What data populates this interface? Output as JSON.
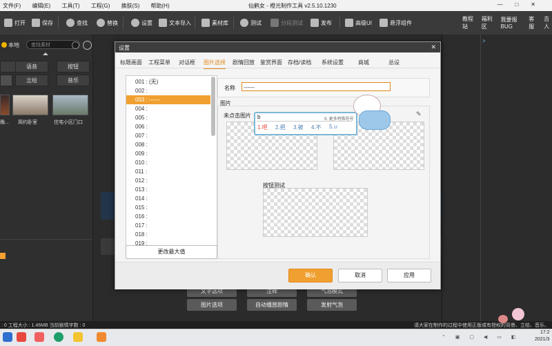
{
  "titlebar": {
    "menu": [
      "文件(F)",
      "编辑(E)",
      "工具(T)",
      "工程(G)",
      "换肤(S)",
      "帮助(H)"
    ],
    "title": "仙鹤女 - 橙光制作工具 v2.5.10.1230",
    "window_controls": [
      "—",
      "□",
      "✕"
    ]
  },
  "toolbar": {
    "items": [
      {
        "label": "打开",
        "icon": "folder-icon"
      },
      {
        "label": "保存",
        "icon": "save-icon"
      },
      {
        "label": "查找",
        "icon": "search-icon"
      },
      {
        "label": "替换",
        "icon": "replace-icon"
      },
      {
        "label": "设置",
        "icon": "gear-icon"
      },
      {
        "label": "文本导入",
        "icon": "text-import-icon"
      },
      {
        "label": "素材库",
        "icon": "library-icon"
      },
      {
        "label": "测试",
        "icon": "play-icon"
      },
      {
        "label": "分段测试",
        "icon": "segment-test-icon"
      },
      {
        "label": "发布",
        "icon": "send-icon"
      },
      {
        "label": "高级UI",
        "icon": "ui-icon"
      },
      {
        "label": "悬浮组件",
        "icon": "float-icon"
      }
    ],
    "right_links": [
      "教程站",
      "福利区",
      "我要报BUG",
      "客服",
      "吉人"
    ]
  },
  "left_panel": {
    "local_label": "本地",
    "search_placeholder": "查找素材",
    "categories": [
      "",
      "语音",
      "按钮",
      "",
      "立绘",
      "音乐"
    ],
    "thumbs": [
      "晚...",
      "简约卧室",
      "住宅小区门口"
    ]
  },
  "dialog": {
    "title": "设置",
    "close": "✕",
    "tabs": [
      "标题画面",
      "工程菜单",
      "对话框",
      "图片选择",
      "剧情回放",
      "鉴赏界面",
      "存档/读档",
      "系统设置",
      "商城",
      "总设"
    ],
    "active_tab": 3,
    "list": [
      "001 : (无)",
      "002 :",
      "003 : ------",
      "004 :",
      "005 :",
      "006 :",
      "007 :",
      "008 :",
      "009 :",
      "010 :",
      "011 :",
      "012 :",
      "013 :",
      "014 :",
      "015 :",
      "016 :",
      "017 :",
      "018 :",
      "019 :"
    ],
    "selected_index": 2,
    "change_max_button": "更改最大值",
    "name_label": "名称",
    "name_value": "------",
    "image_group_label": "图片",
    "unclicked_label": "未点击图片",
    "test_label": "按钮测试",
    "confirm": "确认",
    "cancel": "取消",
    "apply": "应用"
  },
  "ime": {
    "input": "b",
    "hint": "9. 更多特殊符号",
    "candidates": [
      "1.吧",
      "2.把",
      "3.被",
      "4.不",
      "5.∪"
    ]
  },
  "bottom_buttons": [
    "文字选项",
    "注释",
    "气泡模式",
    "图片选项",
    "自动播放剧情",
    "发射气泡"
  ],
  "statusbar": {
    "left": ": 0 工程大小 : 1.46MB 当前剧情字数 : 0",
    "right": "请大家在制作的过程中使用正版或有授权的背景、立绘、音乐、"
  },
  "taskbar": {
    "time": "17:2",
    "date": "2021/3"
  },
  "colors": {
    "accent": "#f0a030",
    "accent_text": "#e0891c",
    "dark_bg": "#2b2b2b",
    "dialog_bg": "#f4f4f4"
  }
}
